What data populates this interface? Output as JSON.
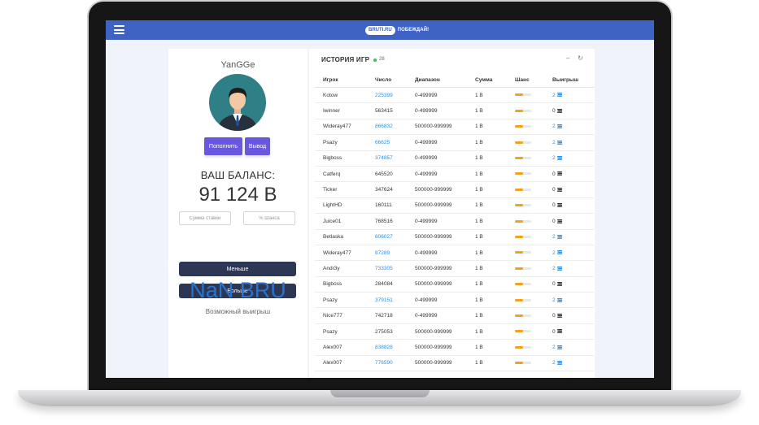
{
  "header": {
    "logo_badge": "BRUTI.RU",
    "logo_text": "ПОБЕЖДАЙ!"
  },
  "profile": {
    "username": "YanGGe",
    "deposit_label": "Пополнить",
    "withdraw_label": "Вывод",
    "balance_label": "ВАШ БАЛАНС:",
    "balance_value": "91 124 B",
    "bet_placeholder": "Сумма ставки",
    "chance_placeholder": "% Шанса",
    "less_label": "Меньше",
    "more_label": "Больше",
    "possible_win_value": "NaN BRU",
    "possible_win_label": "Возможный выигрыш"
  },
  "history": {
    "title": "ИСТОРИЯ ИГР",
    "online_count": "28",
    "minimize_label": "–",
    "refresh_label": "↻",
    "columns": [
      "Игрок",
      "Число",
      "Диапазон",
      "Сумма",
      "Шанс",
      "Выигрыш"
    ],
    "rows": [
      {
        "player": "Kotow",
        "number": "225399",
        "range": "0-499999",
        "amount": "1 B",
        "chance": 0.5,
        "win": "2",
        "won": true
      },
      {
        "player": "Iwinner",
        "number": "563415",
        "range": "0-499999",
        "amount": "1 B",
        "chance": 0.5,
        "win": "0",
        "won": false
      },
      {
        "player": "Wideray477",
        "number": "866832",
        "range": "500000-999999",
        "amount": "1 B",
        "chance": 0.5,
        "win": "2",
        "won": true
      },
      {
        "player": "Psazy",
        "number": "66625",
        "range": "0-499999",
        "amount": "1 B",
        "chance": 0.5,
        "win": "2",
        "won": true
      },
      {
        "player": "Bigboss",
        "number": "374857",
        "range": "0-499999",
        "amount": "1 B",
        "chance": 0.5,
        "win": "2",
        "won": true
      },
      {
        "player": "Catferq",
        "number": "645520",
        "range": "0-499999",
        "amount": "1 B",
        "chance": 0.5,
        "win": "0",
        "won": false
      },
      {
        "player": "Ticker",
        "number": "347624",
        "range": "500000-999999",
        "amount": "1 B",
        "chance": 0.5,
        "win": "0",
        "won": false
      },
      {
        "player": "LightHD",
        "number": "160111",
        "range": "500000-999999",
        "amount": "1 B",
        "chance": 0.5,
        "win": "0",
        "won": false
      },
      {
        "player": "Juice01",
        "number": "768516",
        "range": "0-499999",
        "amount": "1 B",
        "chance": 0.5,
        "win": "0",
        "won": false
      },
      {
        "player": "Betlaska",
        "number": "606027",
        "range": "500000-999999",
        "amount": "1 B",
        "chance": 0.5,
        "win": "2",
        "won": true
      },
      {
        "player": "Wideray477",
        "number": "87289",
        "range": "0-499999",
        "amount": "1 B",
        "chance": 0.5,
        "win": "2",
        "won": true
      },
      {
        "player": "Andr3y",
        "number": "733305",
        "range": "500000-999999",
        "amount": "1 B",
        "chance": 0.5,
        "win": "2",
        "won": true
      },
      {
        "player": "Bigboss",
        "number": "284084",
        "range": "500000-999999",
        "amount": "1 B",
        "chance": 0.5,
        "win": "0",
        "won": false
      },
      {
        "player": "Psazy",
        "number": "379151",
        "range": "0-499999",
        "amount": "1 B",
        "chance": 0.5,
        "win": "2",
        "won": true
      },
      {
        "player": "Nice777",
        "number": "742718",
        "range": "0-499999",
        "amount": "1 B",
        "chance": 0.5,
        "win": "0",
        "won": false
      },
      {
        "player": "Psazy",
        "number": "275053",
        "range": "500000-999999",
        "amount": "1 B",
        "chance": 0.5,
        "win": "0",
        "won": false
      },
      {
        "player": "Alex007",
        "number": "838828",
        "range": "500000-999999",
        "amount": "1 B",
        "chance": 0.5,
        "win": "2",
        "won": true
      },
      {
        "player": "Alex007",
        "number": "776590",
        "range": "500000-999999",
        "amount": "1 B",
        "chance": 0.5,
        "win": "2",
        "won": true
      }
    ]
  },
  "colors": {
    "topbar": "#3f63c3",
    "accent_button": "#6957e0",
    "dark_button": "#2c3756",
    "link_blue": "#2d8fe0",
    "chance_bar": "#f2a31b",
    "online": "#3bbf5a"
  },
  "icons": {
    "menu": "hamburger-menu-icon",
    "coin": "coin-stack-icon",
    "refresh": "refresh-icon",
    "minimize": "minimize-icon"
  }
}
